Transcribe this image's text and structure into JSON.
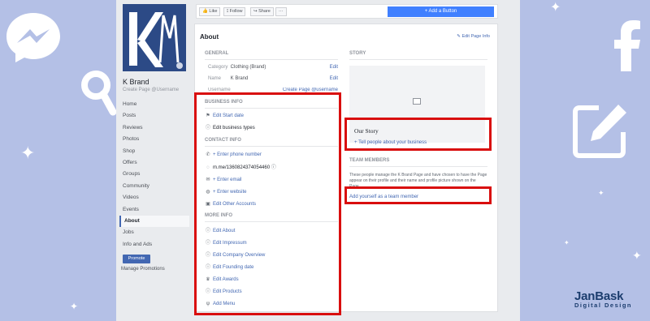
{
  "sidebar": {
    "brand_name": "K Brand",
    "username_link": "Create Page @Username",
    "nav": [
      "Home",
      "Posts",
      "Reviews",
      "Photos",
      "Shop",
      "Offers",
      "Groups",
      "Community",
      "Videos",
      "Events",
      "About",
      "Jobs",
      "Info and Ads"
    ],
    "active_index": 10,
    "promote_label": "Promote",
    "manage_promotions_label": "Manage Promotions"
  },
  "topbar": {
    "like_label": "Like",
    "follow_label": "Follow",
    "share_label": "Share",
    "more_label": "···",
    "add_button_label": "+ Add a Button"
  },
  "about": {
    "title": "About",
    "edit_page_info": "Edit Page Info",
    "general_heading": "GENERAL",
    "category_key": "Category",
    "category_value": "Clothing (Brand)",
    "name_key": "Name",
    "name_value": "K Brand",
    "username_key": "Username",
    "username_value": "Create Page @username",
    "edit_label": "Edit",
    "business_info_heading": "BUSINESS INFO",
    "edit_start_date": "Edit Start date",
    "edit_business_types": "Edit business types",
    "contact_info_heading": "CONTACT INFO",
    "enter_phone": "+ Enter phone number",
    "messenger_link": "m.me/1360824374054460",
    "enter_email": "+ Enter email",
    "enter_website": "+ Enter website",
    "edit_other_accounts": "Edit Other Accounts",
    "more_info_heading": "MORE INFO",
    "edit_about": "Edit About",
    "edit_impressum": "Edit Impressum",
    "edit_company_overview": "Edit Company Overview",
    "edit_founding_date": "Edit Founding date",
    "edit_awards": "Edit Awards",
    "edit_products": "Edit Products",
    "add_menu": "Add Menu"
  },
  "story": {
    "heading": "STORY",
    "our_story": "Our Story",
    "tell_people": "+ Tell people about your business"
  },
  "team": {
    "heading": "TEAM MEMBERS",
    "description": "These people manage the K Brand Page and have chosen to have the Page appear on their profile and their name and profile picture shown on the Page.",
    "add_yourself": "Add yourself as a team member"
  },
  "watermark": {
    "line1": "JanBask",
    "line2": "Digital Design"
  },
  "colors": {
    "background": "#b4c0e6",
    "facebook_blue": "#4267b2",
    "highlight_red": "#d90e0e",
    "add_button": "#4080ff"
  }
}
